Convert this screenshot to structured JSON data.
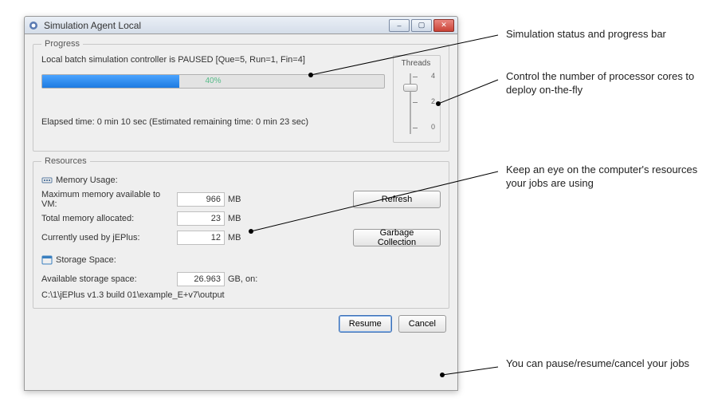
{
  "window": {
    "title": "Simulation Agent Local",
    "buttons": {
      "minimize": "–",
      "maximize": "▢",
      "close": "✕"
    }
  },
  "progress": {
    "legend": "Progress",
    "status": "Local batch simulation controller is PAUSED [Que=5, Run=1, Fin=4]",
    "percent_text": "40%",
    "percent_fill_css_width": "40%",
    "elapsed": "Elapsed time: 0 min 10 sec (Estimated remaining time: 0 min 23 sec)"
  },
  "threads": {
    "label": "Threads",
    "ticks": {
      "t4": "4",
      "t2": "2",
      "t0": "0"
    },
    "thumb_top_px": "35"
  },
  "resources": {
    "legend": "Resources",
    "memory_header": "Memory Usage:",
    "rows": {
      "max_vm": {
        "label": "Maximum memory available to VM:",
        "value": "966",
        "unit": "MB"
      },
      "total_alloc": {
        "label": "Total memory allocated:",
        "value": "23",
        "unit": "MB"
      },
      "used": {
        "label": "Currently used by jEPlus:",
        "value": "12",
        "unit": "MB"
      }
    },
    "buttons": {
      "refresh": "Refresh",
      "gc": "Garbage Collection"
    },
    "storage_header": "Storage Space:",
    "storage": {
      "label": "Available storage space:",
      "value": "26.963",
      "unit": "GB, on:"
    },
    "path": "C:\\1\\jEPlus v1.3 build 01\\example_E+v7\\output"
  },
  "bottom": {
    "resume": "Resume",
    "cancel": "Cancel"
  },
  "annotations": {
    "a1": "Simulation status and progress bar",
    "a2": "Control the number of processor cores to deploy on-the-fly",
    "a3": "Keep an eye on the computer's resources your jobs are using",
    "a4": "You can pause/resume/cancel your jobs"
  }
}
